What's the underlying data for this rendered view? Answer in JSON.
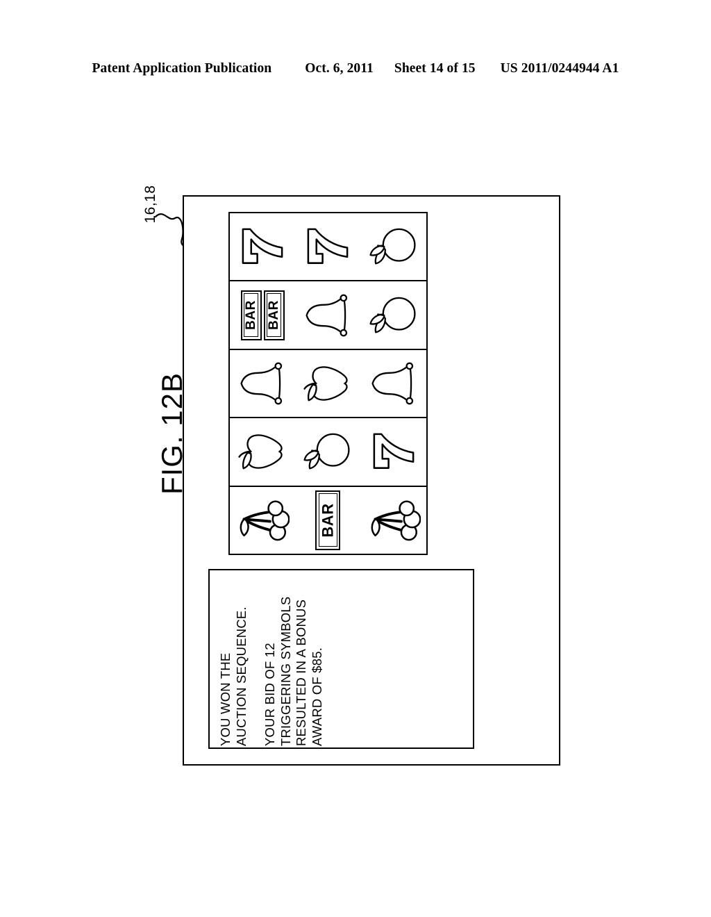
{
  "header": {
    "publication": "Patent Application Publication",
    "date": "Oct. 6, 2011",
    "sheet": "Sheet 14 of 15",
    "patent_number": "US 2011/0244944 A1"
  },
  "figure": {
    "label": "FIG. 12B",
    "reference_numeral": "16,18"
  },
  "slot_display": {
    "reels": [
      {
        "reel_name": "reel-1",
        "symbols": [
          "seven",
          "seven",
          "orange"
        ]
      },
      {
        "reel_name": "reel-2",
        "symbols": [
          "double-bar",
          "bell",
          "orange"
        ]
      },
      {
        "reel_name": "reel-3",
        "symbols": [
          "bell",
          "apple",
          "bell"
        ]
      },
      {
        "reel_name": "reel-4",
        "symbols": [
          "apple",
          "orange",
          "seven"
        ]
      },
      {
        "reel_name": "reel-5",
        "symbols": [
          "cherries",
          "bar",
          "cherries"
        ]
      }
    ],
    "bar_label": "BAR"
  },
  "message": {
    "lines": [
      "YOU WON THE",
      "AUCTION SEQUENCE.",
      "",
      "YOUR BID OF 12",
      "TRIGGERING SYMBOLS",
      "RESULTED IN A BONUS",
      "AWARD OF $85."
    ]
  },
  "colors": {
    "ink": "#000000",
    "paper": "#ffffff"
  }
}
